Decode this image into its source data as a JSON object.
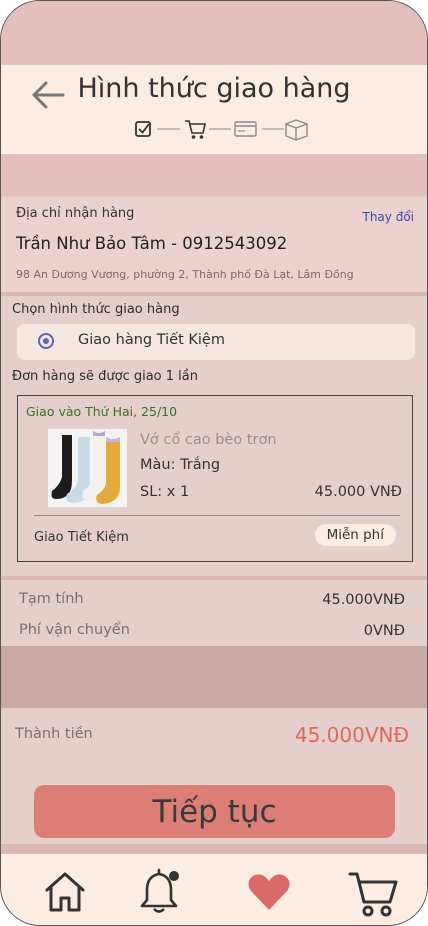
{
  "header": {
    "title": "Hình thức giao hàng",
    "back_icon": "arrow-left-icon",
    "steps": [
      "checkbox-icon",
      "cart-icon",
      "credit-card-icon",
      "box-icon"
    ]
  },
  "address": {
    "label": "Địa chỉ nhận hàng",
    "change_link": "Thay đổi",
    "recipient": "Trần Như Bảo Tâm - 0912543092",
    "street": "98 An Dương Vương, phường 2, Thành phố Đà Lạt, Lâm Đồng"
  },
  "shipping": {
    "section_label": "Chọn hình thức giao hàng",
    "selected_option": "Giao hàng Tiết Kiệm"
  },
  "order": {
    "once_label": "Đơn hàng sẽ được giao 1 lần",
    "delivery_date": "Giao vào Thứ Hai, 25/10",
    "product": {
      "name": "Vớ cổ cao bèo trơn",
      "color": "Màu: Trắng",
      "quantity": "SL: x 1",
      "price": "45.000 VNĐ"
    },
    "ship_method": "Giao Tiết Kiệm",
    "ship_badge": "Miễn phí"
  },
  "summary": {
    "subtotal_label": "Tạm tính",
    "subtotal_value": "45.000VNĐ",
    "fee_label": "Phí vận chuyển",
    "fee_value": "0VNĐ",
    "total_label": "Thành tiền",
    "total_value": "45.000VNĐ"
  },
  "actions": {
    "continue_label": "Tiếp tục"
  },
  "nav": {
    "items": [
      "home-icon",
      "bell-icon",
      "heart-icon",
      "cart-icon"
    ]
  },
  "colors": {
    "accent_button": "#dd7e76",
    "total_price": "#e0685a",
    "date_green": "#3c6d2a",
    "link_blue": "#3b4aa8",
    "heart": "#d96a67"
  }
}
